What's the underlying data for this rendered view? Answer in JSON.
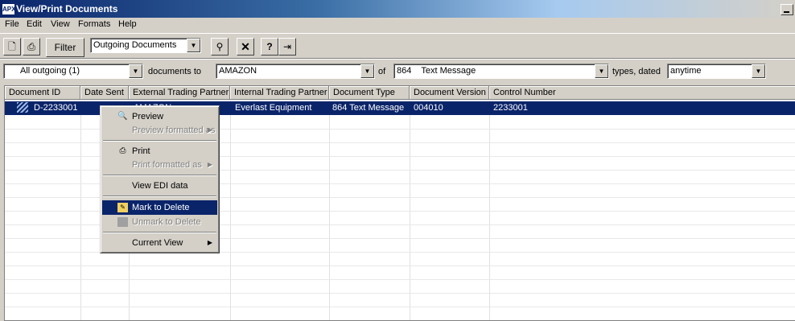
{
  "window": {
    "title": "View/Print Documents",
    "app_icon_text": "APX"
  },
  "menubar": [
    "File",
    "Edit",
    "View",
    "Formats",
    "Help"
  ],
  "toolbar": {
    "filter_label": "Filter",
    "view_select": "Outgoing Documents",
    "icons": [
      "preview-icon",
      "print-icon",
      "find-icon",
      "delete-icon",
      "help-icon",
      "exit-icon"
    ]
  },
  "filterbar": {
    "status_select": "All outgoing (1)",
    "documents_to_label": "documents to",
    "partner_select": "AMAZON",
    "of_label": "of",
    "type_select": "864    Text Message",
    "types_dated_label": "types, dated",
    "date_select": "anytime"
  },
  "grid": {
    "columns": [
      "Document ID",
      "Date Sent",
      "External Trading Partner",
      "Internal Trading Partner",
      "Document Type",
      "Document Version",
      "Control Number"
    ],
    "rows": [
      {
        "document_id": "D-2233001",
        "date_sent": "",
        "external_partner": "AMAZON",
        "internal_partner": "Everlast Equipment",
        "document_type": "864 Text Message",
        "document_version": "004010",
        "control_number": "2233001"
      }
    ]
  },
  "context_menu": {
    "preview": "Preview",
    "preview_formatted": "Preview formatted as",
    "print": "Print",
    "print_formatted": "Print formatted as",
    "view_edi": "View EDI data",
    "mark_delete": "Mark to Delete",
    "unmark_delete": "Unmark to Delete",
    "current_view": "Current View"
  }
}
